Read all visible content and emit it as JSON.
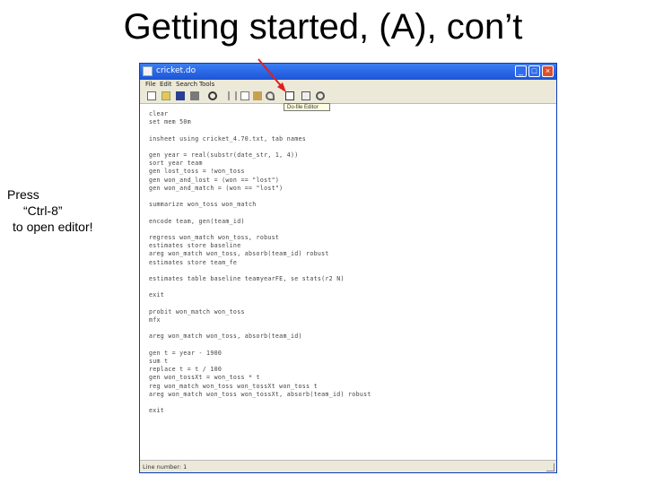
{
  "slide": {
    "title": "Getting started, (A), con’t",
    "side_note": [
      "Press",
      "“Ctrl-8”",
      "to open editor!"
    ]
  },
  "window": {
    "title": "cricket.do",
    "menu": [
      "File",
      "Edit",
      "Search",
      "Tools"
    ],
    "tooltip": "Do-file Editor",
    "controls": [
      "_",
      "□",
      "×"
    ],
    "status": "Line number: 1",
    "colors": {
      "titlebar": "#1c55d6",
      "chrome": "#ece9d8",
      "arrow": "#e02020"
    }
  },
  "editor": {
    "lines": [
      "clear",
      "set mem 50m",
      "",
      "insheet using cricket_4.70.txt, tab names",
      "",
      "gen year = real(substr(date_str, 1, 4))",
      "sort year team",
      "gen lost_toss = !won_toss",
      "gen won_and_lost = (won == \"lost\")",
      "gen won_and_match = (won == \"lost\")",
      "",
      "summarize won_toss won_match",
      "",
      "encode team, gen(team_id)",
      "",
      "regress won_match won_toss, robust",
      "estimates store baseline",
      "areg won_match won_toss, absorb(team_id) robust",
      "estimates store team_fe",
      "",
      "estimates table baseline teamyearFE, se stats(r2 N)",
      "",
      "exit",
      "",
      "probit won_match won_toss",
      "mfx",
      "",
      "areg won_match won_toss, absorb(team_id)",
      "",
      "gen t = year - 1900",
      "sum t",
      "replace t = t / 100",
      "gen won_tossXt = won_toss * t",
      "reg won_match won_toss won_tossXt won_toss t",
      "areg won_match won_toss won_tossXt, absorb(team_id) robust",
      "",
      "exit"
    ]
  }
}
